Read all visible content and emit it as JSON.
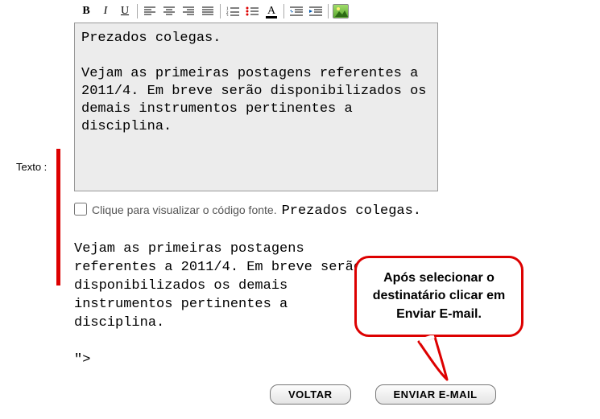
{
  "label": "Texto :",
  "toolbar": {
    "bold": "B",
    "italic": "I",
    "underline": "U",
    "fontcolor_letter": "A"
  },
  "editor": {
    "content": "Prezados colegas.\n\nVejam as primeiras postagens referentes a 2011/4. Em breve serão disponibilizados os demais instrumentos pertinentes a disciplina."
  },
  "source": {
    "checkbox_checked": false,
    "label": "Clique para visualizar o código fonte.",
    "inline_start": "Prezados colegas."
  },
  "preview": {
    "content": "\nVejam as primeiras postagens referentes a 2011/4. Em breve serão disponibilizados os demais instrumentos pertinentes a disciplina.\n\n\">"
  },
  "callout": {
    "text": "Após selecionar o destinatário clicar em Enviar E-mail."
  },
  "buttons": {
    "back": "VOLTAR",
    "send": "ENVIAR E-MAIL"
  }
}
